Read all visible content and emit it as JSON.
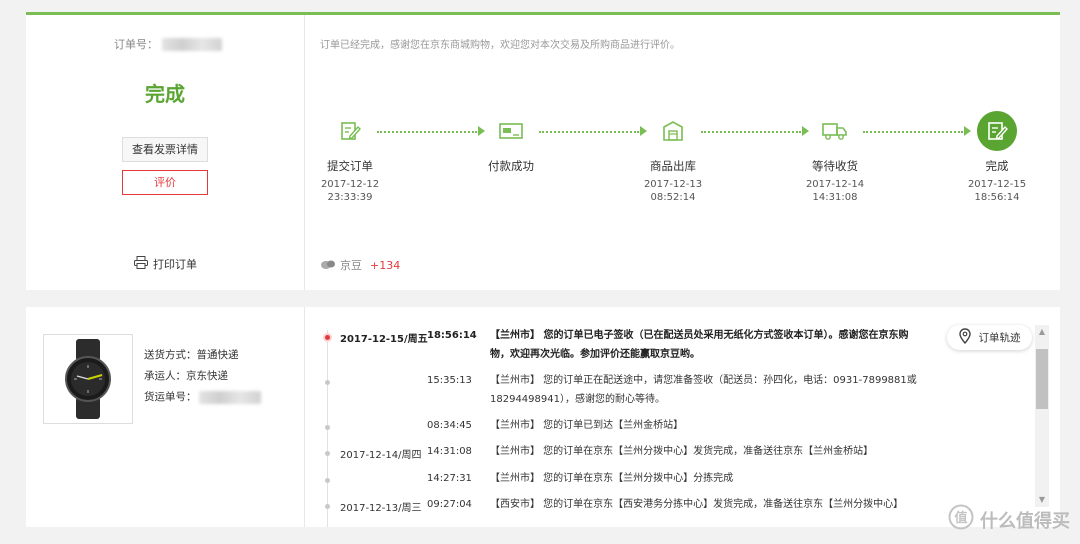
{
  "order": {
    "number_label": "订单号：",
    "status": "完成",
    "invoice_button": "查看发票详情",
    "rate_button": "评价",
    "print_label": "打印订单",
    "complete_message": "订单已经完成，感谢您在京东商城购物，欢迎您对本次交易及所购商品进行评价。",
    "beans_label": "京豆",
    "beans_value": "+134"
  },
  "progress_steps": [
    {
      "label": "提交订单",
      "date": "2017-12-12",
      "time": "23:33:39",
      "icon": "submit-order-icon"
    },
    {
      "label": "付款成功",
      "date": "",
      "time": "",
      "icon": "payment-icon"
    },
    {
      "label": "商品出库",
      "date": "2017-12-13",
      "time": "08:52:14",
      "icon": "warehouse-out-icon"
    },
    {
      "label": "等待收货",
      "date": "2017-12-14",
      "time": "14:31:08",
      "icon": "delivery-truck-icon"
    },
    {
      "label": "完成",
      "date": "2017-12-15",
      "time": "18:56:14",
      "icon": "complete-icon"
    }
  ],
  "shipping": {
    "method_label": "送货方式：普通快递",
    "carrier_label": "承运人：京东快递",
    "tracking_label": "货运单号："
  },
  "tracking_button": "订单轨迹",
  "tracking": [
    {
      "date": "2017-12-15/周五",
      "time": "18:56:14",
      "msg": "【兰州市】 您的订单已电子签收（已在配送员处采用无纸化方式签收本订单）。感谢您在京东购物，欢迎再次光临。参加评价还能赢取京豆哟。"
    },
    {
      "date": "",
      "time": "15:35:13",
      "msg": "【兰州市】 您的订单正在配送途中，请您准备签收（配送员：孙四化，电话：0931-7899881或18294498941），感谢您的耐心等待。"
    },
    {
      "date": "",
      "time": "08:34:45",
      "msg": "【兰州市】 您的订单已到达【兰州金桥站】"
    },
    {
      "date": "2017-12-14/周四",
      "time": "14:31:08",
      "msg": "【兰州市】 您的订单在京东【兰州分拨中心】发货完成，准备送往京东【兰州金桥站】"
    },
    {
      "date": "",
      "time": "14:27:31",
      "msg": "【兰州市】 您的订单在京东【兰州分拨中心】分拣完成"
    },
    {
      "date": "2017-12-13/周三",
      "time": "09:27:04",
      "msg": "【西安市】 您的订单在京东【西安港务分拣中心】发货完成，准备送往京东【兰州分拨中心】"
    }
  ],
  "watermark": "什么值得买",
  "colors": {
    "accent_green": "#5aa532",
    "red": "#e4393c"
  }
}
